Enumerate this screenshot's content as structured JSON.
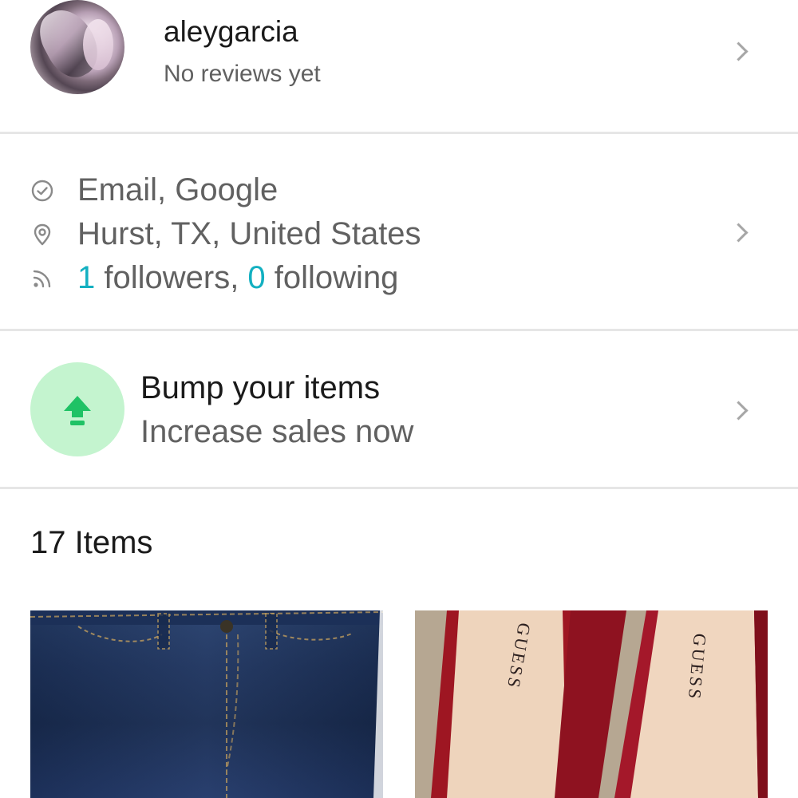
{
  "profile": {
    "username": "aleygarcia",
    "reviews": "No reviews yet"
  },
  "info": {
    "verified": "Email, Google",
    "location": "Hurst, TX, United States",
    "followers_count": "1",
    "followers_label": " followers, ",
    "following_count": "0",
    "following_label": " following"
  },
  "bump": {
    "title": "Bump your items",
    "subtitle": "Increase sales now"
  },
  "items": {
    "count_label": "17 Items",
    "list": [
      {
        "name": "jeans",
        "brand_text": ""
      },
      {
        "name": "shoes",
        "brand_text": "GUESS"
      }
    ]
  },
  "colors": {
    "accent": "#13b0c1",
    "bump_bg": "#c4f4cf",
    "bump_icon": "#1fc265",
    "divider": "#e6e6e6"
  },
  "icons": [
    "check-circle-icon",
    "location-pin-icon",
    "feed-icon",
    "chevron-right-icon",
    "up-arrow-icon"
  ]
}
